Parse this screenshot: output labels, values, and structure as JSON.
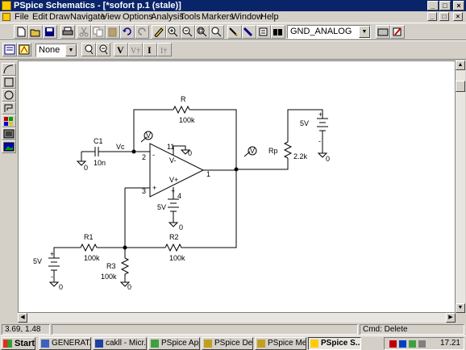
{
  "window": {
    "title": "PSpice Schematics - [*sofort  p.1 (stale)]"
  },
  "menu": [
    "File",
    "Edit",
    "Draw",
    "Navigate",
    "View",
    "Options",
    "Analysis",
    "Tools",
    "Markers",
    "Window",
    "Help"
  ],
  "toolbar1": {
    "part_combo_value": "GND_ANALOG"
  },
  "toolbar2": {
    "zoom_combo_value": "None"
  },
  "schematic": {
    "R_label": "R",
    "R_value": "100k",
    "C1_label": "C1",
    "C1_value": "10n",
    "Vc_label": "Vc",
    "Rp_label": "Rp",
    "Rp_value": "2.2k",
    "R1_label": "R1",
    "R1_value": "100k",
    "R2_label": "R2",
    "R2_value": "100k",
    "R3_label": "R3",
    "R3_value": "100k",
    "V_top_right": "5V",
    "V_opamp": "5V",
    "V_left": "5V",
    "pin2": "2",
    "pin3": "3",
    "pin11": "11",
    "pin4": "4",
    "pin1": "1",
    "vminus": "V-",
    "vplus": "V+",
    "minus": "-",
    "plus": "+",
    "gnd0": "0",
    "marker": "V"
  },
  "status": {
    "coords": "3.69, 1.48",
    "cmd": "Cmd: Delete"
  },
  "taskbar": {
    "start": "Start",
    "tasks": [
      "GENERAT...",
      "cakll - Micr...",
      "PSpice App...",
      "PSpice Des...",
      "PSpice Me...",
      "PSpice S..."
    ],
    "clock": "17.21"
  },
  "colors": {
    "titlebar": "#0a246a",
    "face": "#d4d0c8"
  }
}
